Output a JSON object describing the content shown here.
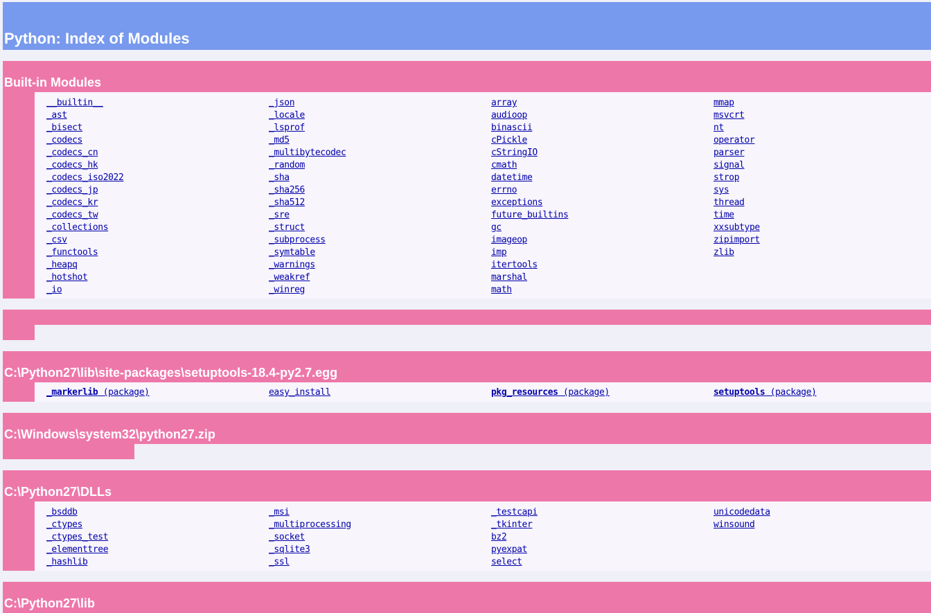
{
  "page": {
    "title": "Python: Index of Modules"
  },
  "builtin": {
    "heading": "Built-in Modules",
    "columns": [
      [
        "__builtin__",
        "_ast",
        "_bisect",
        "_codecs",
        "_codecs_cn",
        "_codecs_hk",
        "_codecs_iso2022",
        "_codecs_jp",
        "_codecs_kr",
        "_codecs_tw",
        "_collections",
        "_csv",
        "_functools",
        "_heapq",
        "_hotshot",
        "_io"
      ],
      [
        "_json",
        "_locale",
        "_lsprof",
        "_md5",
        "_multibytecodec",
        "_random",
        "_sha",
        "_sha256",
        "_sha512",
        "_sre",
        "_struct",
        "_subprocess",
        "_symtable",
        "_warnings",
        "_weakref",
        "_winreg"
      ],
      [
        "array",
        "audioop",
        "binascii",
        "cPickle",
        "cStringIO",
        "cmath",
        "datetime",
        "errno",
        "exceptions",
        "future_builtins",
        "gc",
        "imageop",
        "imp",
        "itertools",
        "marshal",
        "math"
      ],
      [
        "mmap",
        "msvcrt",
        "nt",
        "operator",
        "parser",
        "signal",
        "strop",
        "sys",
        "thread",
        "time",
        "xxsubtype",
        "zipimport",
        "zlib"
      ]
    ]
  },
  "empty_section": {
    "heading": ""
  },
  "setuptools": {
    "heading": "C:\\Python27\\lib\\site-packages\\setuptools-18.4-py2.7.egg",
    "items": [
      {
        "name": "_markerlib",
        "suffix": " (package)"
      },
      {
        "name": "easy_install",
        "suffix": ""
      },
      {
        "name": "pkg_resources",
        "suffix": " (package)"
      },
      {
        "name": "setuptools",
        "suffix": " (package)"
      }
    ]
  },
  "pythonzip": {
    "heading": "C:\\Windows\\system32\\python27.zip"
  },
  "dlls": {
    "heading": "C:\\Python27\\DLLs",
    "columns": [
      [
        "_bsddb",
        "_ctypes",
        "_ctypes_test",
        "_elementtree",
        "_hashlib"
      ],
      [
        "_msi",
        "_multiprocessing",
        "_socket",
        "_sqlite3",
        "_ssl"
      ],
      [
        "_testcapi",
        "_tkinter",
        "bz2",
        "pyexpat",
        "select"
      ],
      [
        "unicodedata",
        "winsound"
      ]
    ]
  },
  "lib": {
    "heading": "C:\\Python27\\lib"
  },
  "colors": {
    "title_bg": "#7799ee",
    "section_bg": "#ee77aa",
    "body_bg": "#f8f5fc",
    "link": "#0000aa"
  }
}
